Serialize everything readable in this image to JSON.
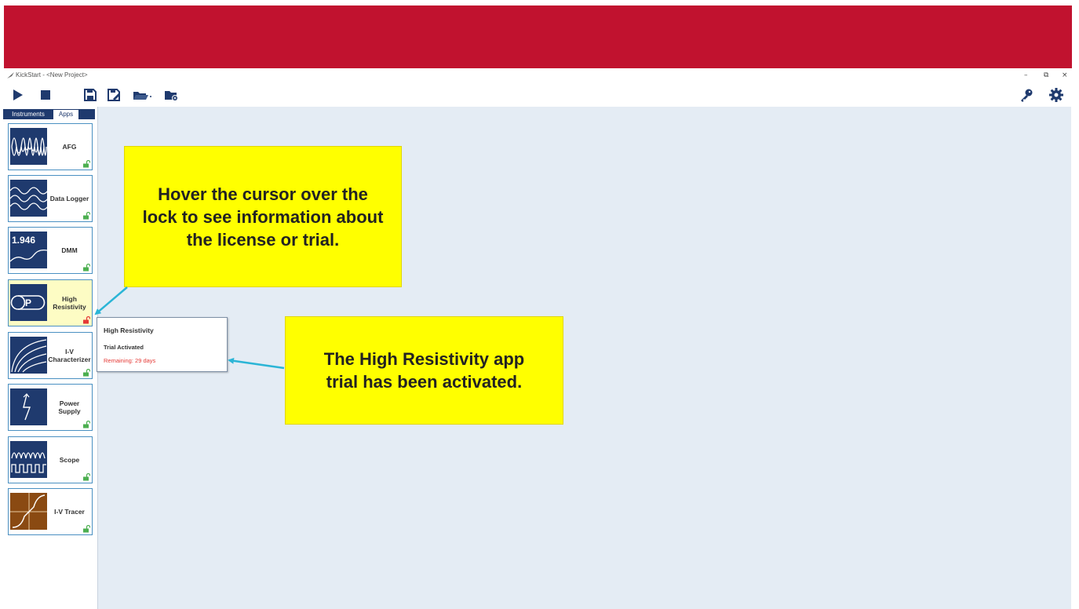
{
  "window": {
    "title": "KickStart - <New Project>",
    "controls": {
      "minimize": "–",
      "restore": "⧉",
      "close": "×"
    }
  },
  "colors": {
    "banner": "#c1122f",
    "navy": "#1f3a6e",
    "workspace": "#e4ecf4",
    "callout": "#ffff00",
    "lock_open": "#4caf50",
    "lock_active": "#e53935"
  },
  "toolbar": {
    "left_icons": [
      "run-icon",
      "stop-icon",
      "save-icon",
      "save-as-icon",
      "open-folder-icon",
      "new-folder-icon"
    ],
    "right_icons": [
      "license-key-icon",
      "settings-gear-icon"
    ]
  },
  "sidebar": {
    "tabs": [
      {
        "label": "Instruments",
        "selected": false
      },
      {
        "label": "Apps",
        "selected": true
      }
    ],
    "apps": [
      {
        "label": "AFG",
        "icon": "afg-waveform-icon",
        "lock": "open"
      },
      {
        "label": "Data Logger",
        "icon": "data-logger-icon",
        "lock": "open"
      },
      {
        "label": "DMM",
        "icon": "dmm-icon",
        "thumb_text": "1.946",
        "lock": "open"
      },
      {
        "label": "High Resistivity",
        "icon": "high-resistivity-icon",
        "thumb_text": "P",
        "lock": "trial",
        "active": true
      },
      {
        "label": "I-V Characterizer",
        "icon": "iv-characterizer-icon",
        "lock": "open"
      },
      {
        "label": "Power Supply",
        "icon": "power-supply-icon",
        "lock": "open"
      },
      {
        "label": "Scope",
        "icon": "scope-icon",
        "lock": "open"
      },
      {
        "label": "I-V Tracer",
        "icon": "iv-tracer-icon",
        "lock": "open"
      }
    ]
  },
  "tooltip": {
    "title": "High Resistivity",
    "status": "Trial Activated",
    "remaining": "Remaining: 29 days"
  },
  "callouts": {
    "lock_hint": "Hover the cursor over the lock to see information about the license or trial.",
    "trial_info": "The High Resistivity app trial has been activated."
  }
}
